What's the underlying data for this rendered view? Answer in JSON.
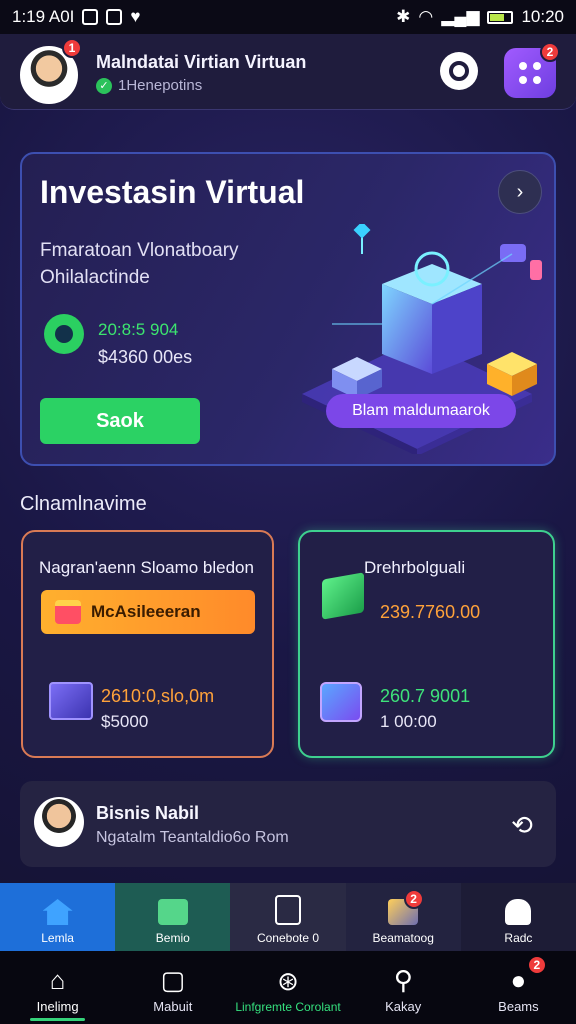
{
  "status_bar": {
    "left_text": "1:19 A0I",
    "time": "10:20"
  },
  "header": {
    "title": "Malndatai Virtian Virtuan",
    "subtitle": "1Henepotins",
    "avatar_badge": "1",
    "menu_badge": "2"
  },
  "hero": {
    "title": "Investasin Virtual",
    "desc_line1": "Fmaratoan Vlonatboary",
    "desc_line2": "Ohilalactinde",
    "value_green": "20:8:5 904",
    "value_white": "$4360 00es",
    "button_label": "Saok",
    "chip_label": "Blam maldumaarok"
  },
  "section": {
    "title": "Clnamlnavime"
  },
  "card_left": {
    "title": "Nagran'aenn Sloamo bledon",
    "button_label": "McAsileeeran",
    "value_orange": "2610:0,slo,0m",
    "value_white": "$5000"
  },
  "card_right": {
    "title": "Drehrbolguali",
    "value_orange": "239.7760.00",
    "value_green": "260.7 9001",
    "value_white": "1 00:00"
  },
  "user_card": {
    "name": "Bisnis Nabil",
    "subtitle": "Ngatalm Teantaldio6o Rom"
  },
  "sub_nav": [
    {
      "label": "Lemla"
    },
    {
      "label": "Bemio"
    },
    {
      "label": "Conebote 0"
    },
    {
      "label": "Beamatoog",
      "badge": "2"
    },
    {
      "label": "Radc"
    }
  ],
  "bottom_nav": [
    {
      "label": "Inelimg"
    },
    {
      "label": "Mabuit"
    },
    {
      "label": "Linfgremte Corolant"
    },
    {
      "label": "Kakay"
    },
    {
      "label": "Beams",
      "badge": "2"
    }
  ],
  "colors": {
    "accent_green": "#2bd264",
    "accent_purple": "#7c47e8",
    "accent_orange": "#ff9a2a",
    "badge_red": "#ef3b3b"
  }
}
